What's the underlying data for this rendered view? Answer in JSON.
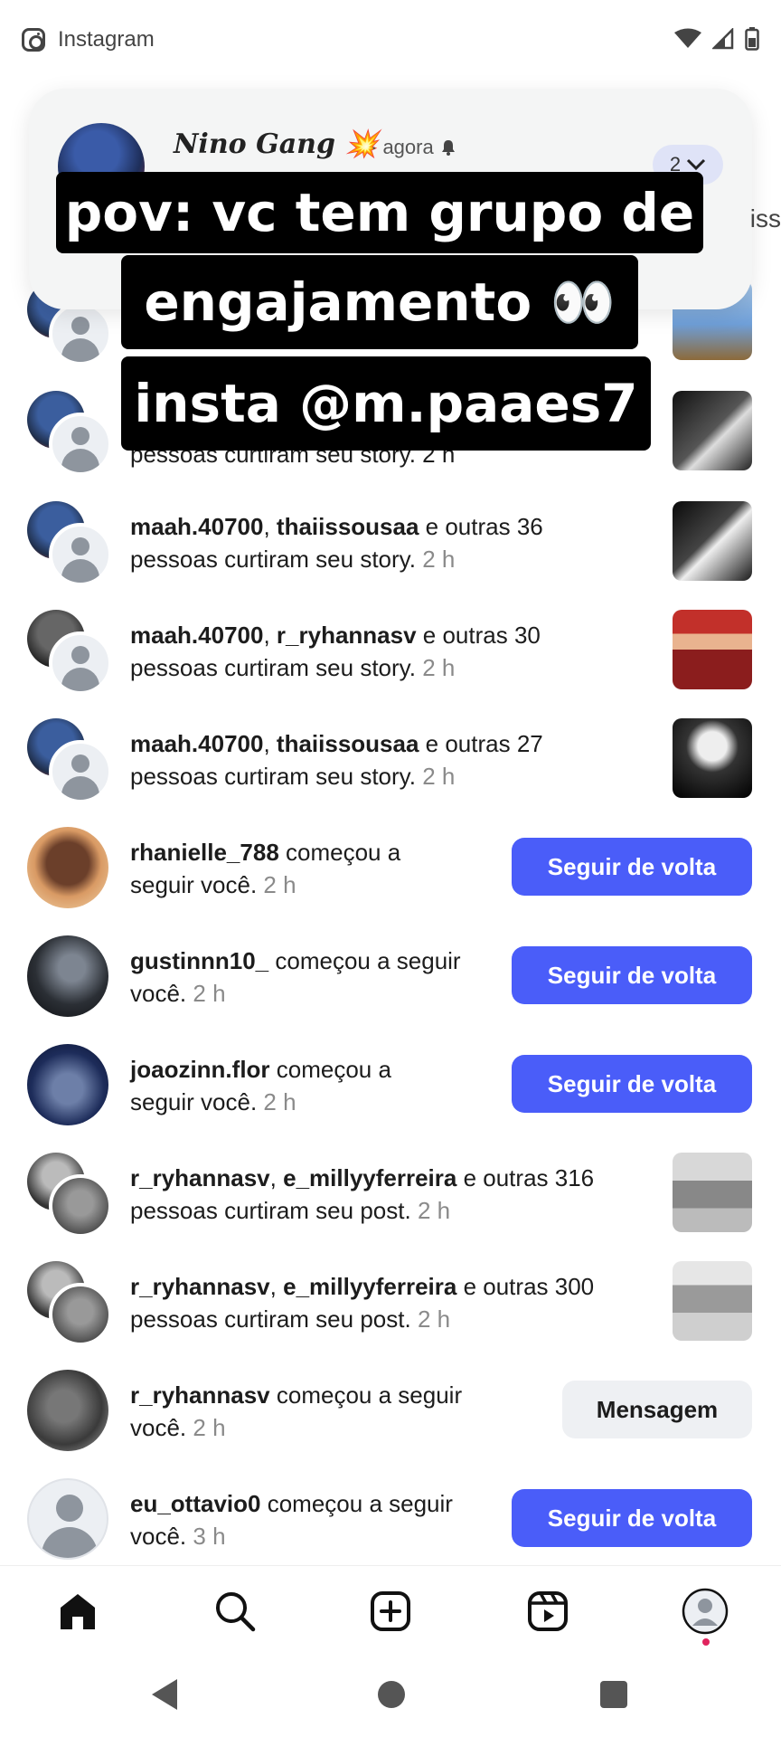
{
  "status_bar": {
    "app_name": "Instagram"
  },
  "popup": {
    "title": "Nino Gang",
    "title_emoji": "💥",
    "meta": "· agora",
    "count": "2",
    "right_peek": "iss"
  },
  "captions": {
    "line1": "pov: vc tem grupo de",
    "line2": "engajamento 👀",
    "line3": "insta @m.paaes7"
  },
  "notifications": [
    {
      "type": "like",
      "user1": "maah.40700",
      "user2": "thaiissousaa",
      "rest": " e outras 36",
      "line2": "pessoas curtiram seu story.",
      "time": "2 h"
    },
    {
      "type": "like",
      "user1": "maah.40700",
      "user2": "r_ryhannasv",
      "rest": " e outras 30",
      "line2": "pessoas curtiram seu story.",
      "time": "2 h"
    },
    {
      "type": "like",
      "user1": "maah.40700",
      "user2": "thaiissousaa",
      "rest": " e outras 27",
      "line2": "pessoas curtiram seu story.",
      "time": "2 h"
    },
    {
      "type": "follow",
      "user": "rhanielle_788",
      "text1": " começou a",
      "line2": "seguir você.",
      "time": "2 h",
      "button": "Seguir de volta"
    },
    {
      "type": "follow",
      "user": "gustinnn10_",
      "text1": " começou a seguir",
      "line2": "você.",
      "time": "2 h",
      "button": "Seguir de volta"
    },
    {
      "type": "follow",
      "user": "joaozinn.flor",
      "text1": " começou a",
      "line2": "seguir você.",
      "time": "2 h",
      "button": "Seguir de volta"
    },
    {
      "type": "like",
      "user1": "r_ryhannasv",
      "user2": "e_millyyferreira",
      "rest": " e outras 316",
      "line2": "pessoas curtiram seu post.",
      "time": "2 h"
    },
    {
      "type": "like",
      "user1": "r_ryhannasv",
      "user2": "e_millyyferreira",
      "rest": " e outras 300",
      "line2": "pessoas curtiram seu post.",
      "time": "2 h"
    },
    {
      "type": "follow",
      "user": "r_ryhannasv",
      "text1": " começou a seguir",
      "line2": "você.",
      "time": "2 h",
      "button": "Mensagem"
    },
    {
      "type": "follow",
      "user": "eu_ottavio0",
      "text1": " começou a seguir",
      "line2": "você.",
      "time": "3 h",
      "button": "Seguir de volta"
    }
  ],
  "partial_row_text": "pessoas curtiram seu story. 2 h",
  "bottom_nav": [
    "home-icon",
    "search-icon",
    "create-icon",
    "reels-icon",
    "profile-icon"
  ],
  "colors": {
    "accent": "#4a5df9",
    "notification_dot": "#e0245e"
  }
}
